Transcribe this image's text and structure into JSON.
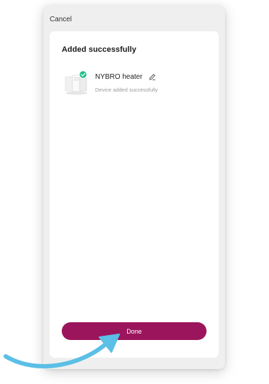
{
  "header": {
    "cancel_label": "Cancel"
  },
  "card": {
    "title": "Added successfully"
  },
  "device": {
    "name": "NYBRO heater",
    "status": "Device added successfully",
    "thumbnail_icon": "heater-device-icon",
    "badge_icon": "check-badge-icon",
    "edit_icon": "pencil-edit-icon"
  },
  "footer": {
    "done_label": "Done"
  },
  "colors": {
    "accent": "#9b155c",
    "success_badge": "#1fbe8a",
    "arrow": "#5bbfe6"
  }
}
